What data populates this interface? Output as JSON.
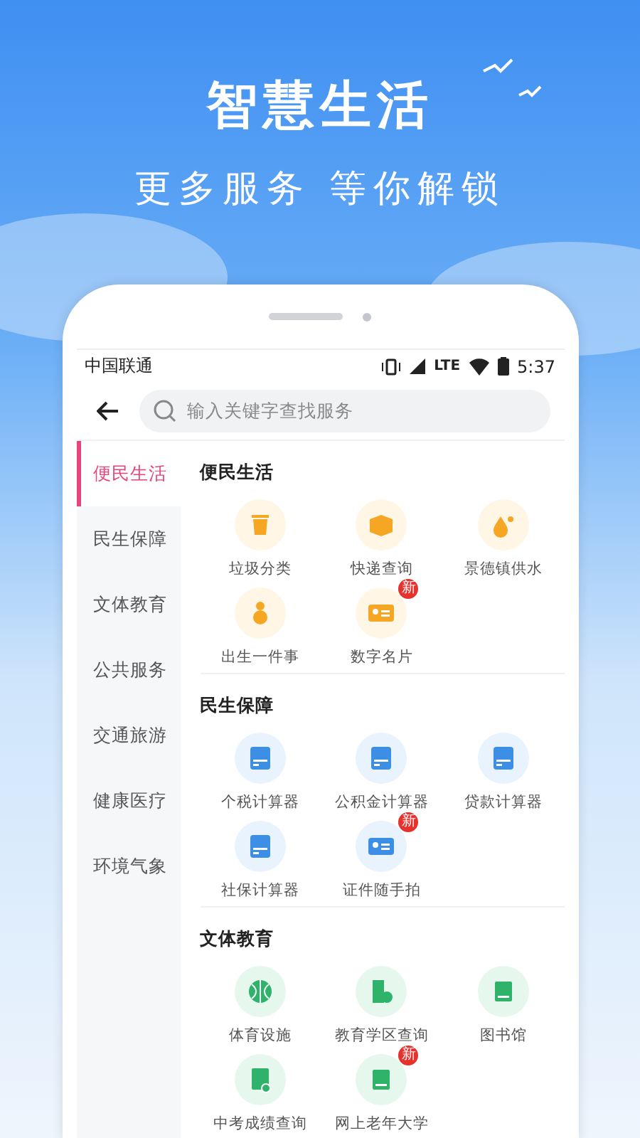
{
  "headline": "智慧生活",
  "subheadline": "更多服务 等你解锁",
  "status_bar": {
    "carrier": "中国联通",
    "network": "LTE",
    "time": "5:37"
  },
  "search": {
    "placeholder": "输入关键字查找服务"
  },
  "sidebar": {
    "items": [
      {
        "label": "便民生活",
        "selected": true
      },
      {
        "label": "民生保障",
        "selected": false
      },
      {
        "label": "文体教育",
        "selected": false
      },
      {
        "label": "公共服务",
        "selected": false
      },
      {
        "label": "交通旅游",
        "selected": false
      },
      {
        "label": "健康医疗",
        "selected": false
      },
      {
        "label": "环境气象",
        "selected": false
      }
    ]
  },
  "sections": [
    {
      "title": "便民生活",
      "color": "#f5a623",
      "items": [
        {
          "label": "垃圾分类"
        },
        {
          "label": "快递查询"
        },
        {
          "label": "景德镇供水"
        },
        {
          "label": "出生一件事"
        },
        {
          "label": "数字名片",
          "badge": "新"
        }
      ]
    },
    {
      "title": "民生保障",
      "color": "#3d8fe6",
      "items": [
        {
          "label": "个税计算器"
        },
        {
          "label": "公积金计算器"
        },
        {
          "label": "贷款计算器"
        },
        {
          "label": "社保计算器"
        },
        {
          "label": "证件随手拍",
          "badge": "新"
        }
      ]
    },
    {
      "title": "文体教育",
      "color": "#2fb36b",
      "items": [
        {
          "label": "体育设施"
        },
        {
          "label": "教育学区查询"
        },
        {
          "label": "图书馆"
        },
        {
          "label": "中考成绩查询"
        },
        {
          "label": "网上老年大学",
          "badge": "新"
        }
      ]
    }
  ]
}
